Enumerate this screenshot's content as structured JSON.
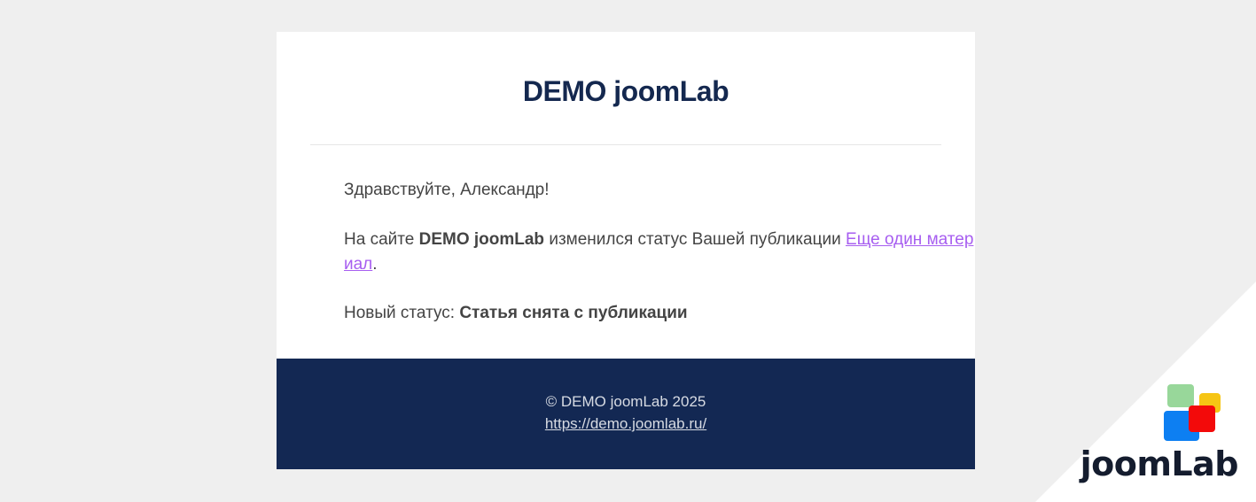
{
  "email": {
    "site_title": "DEMO joomLab",
    "greeting": "Здравствуйте, Александр!",
    "status_prefix": "На сайте ",
    "status_site_bold": "DEMO joomLab",
    "status_middle": " изменился статус Вашей публикации ",
    "status_link_text": "Еще один материал",
    "status_suffix": ".",
    "new_status_label": "Новый статус: ",
    "new_status_value": "Статья снята с публикации",
    "footer_copyright": "© DEMO joomLab 2025",
    "footer_link": "https://demo.joomlab.ru/"
  },
  "brand": {
    "logo_text": "joomLab",
    "colors": {
      "navy": "#132853",
      "link_purple": "#a75ef0",
      "logo_green": "#98d79a",
      "logo_yellow": "#f6c514",
      "logo_blue": "#0d7ff2",
      "logo_red": "#f30a0a"
    }
  }
}
